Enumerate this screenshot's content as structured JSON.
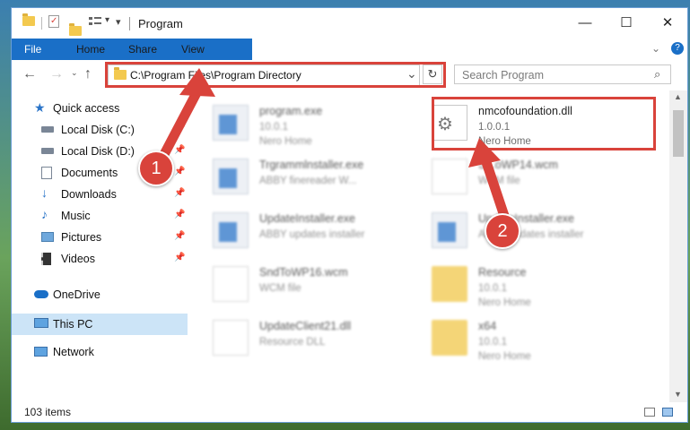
{
  "window": {
    "title": "Program",
    "controls": {
      "minimize": "—",
      "maximize": "☐",
      "close": "✕"
    }
  },
  "ribbon": {
    "tabs": [
      "File",
      "Home",
      "Share",
      "View"
    ],
    "help": "?"
  },
  "address": {
    "path": "C:\\Program Files\\Program Directory",
    "refresh": "↻",
    "dropdown": "⌄"
  },
  "search": {
    "placeholder": "Search Program"
  },
  "sidebar": {
    "items": [
      {
        "label": "Quick access",
        "icon": "star-icon",
        "pinned": false,
        "selected": false
      },
      {
        "label": "Local Disk (C:)",
        "icon": "drive-icon",
        "pinned": true,
        "selected": false
      },
      {
        "label": "Local Disk (D:)",
        "icon": "drive-icon",
        "pinned": true,
        "selected": false
      },
      {
        "label": "Documents",
        "icon": "documents-icon",
        "pinned": true,
        "selected": false
      },
      {
        "label": "Downloads",
        "icon": "downloads-icon",
        "pinned": true,
        "selected": false
      },
      {
        "label": "Music",
        "icon": "music-icon",
        "pinned": true,
        "selected": false
      },
      {
        "label": "Pictures",
        "icon": "pictures-icon",
        "pinned": true,
        "selected": false
      },
      {
        "label": "Videos",
        "icon": "videos-icon",
        "pinned": true,
        "selected": false
      },
      {
        "label": "OneDrive",
        "icon": "cloud-icon",
        "pinned": false,
        "selected": false
      },
      {
        "label": "This PC",
        "icon": "computer-icon",
        "pinned": false,
        "selected": true
      },
      {
        "label": "Network",
        "icon": "network-icon",
        "pinned": false,
        "selected": false
      }
    ]
  },
  "files": [
    {
      "name": "program.exe",
      "line2": "10.0.1",
      "line3": "Nero Home",
      "icon": "program-icon",
      "blurred": true
    },
    {
      "name": "nmcofoundation.dll",
      "line2": "1.0.0.1",
      "line3": "Nero Home",
      "icon": "dll-gear-icon",
      "blurred": false
    },
    {
      "name": "Trgrammlnstaller.exe",
      "line2": "ABBY finereader W...",
      "line3": "",
      "icon": "exe-icon",
      "blurred": true
    },
    {
      "name": "S...oWP14.wcm",
      "line2": "WCM file",
      "line3": "",
      "icon": "document-icon",
      "blurred": true
    },
    {
      "name": "UpdateInstaller.exe",
      "line2": "ABBY updates installer",
      "line3": "",
      "icon": "exe-icon",
      "blurred": true
    },
    {
      "name": "UpdateInstaller.exe",
      "line2": "ABBY updates installer",
      "line3": "",
      "icon": "exe-icon",
      "blurred": true
    },
    {
      "name": "SndToWP16.wcm",
      "line2": "WCM file",
      "line3": "",
      "icon": "document-icon",
      "blurred": true
    },
    {
      "name": "Resource",
      "line2": "10.0.1",
      "line3": "Nero Home",
      "icon": "folder-icon",
      "blurred": true
    },
    {
      "name": "UpdateClient21.dll",
      "line2": "Resource DLL",
      "line3": "",
      "icon": "dll-icon",
      "blurred": true
    },
    {
      "name": "x64",
      "line2": "10.0.1",
      "line3": "Nero Home",
      "icon": "folder-icon",
      "blurred": true
    }
  ],
  "status": {
    "item_count": "103 items"
  },
  "callouts": {
    "one": "1",
    "two": "2"
  },
  "colors": {
    "accent": "#1a6fc7",
    "highlight": "#d9433b",
    "selection": "#cce4f7",
    "folder": "#f3c94f"
  }
}
